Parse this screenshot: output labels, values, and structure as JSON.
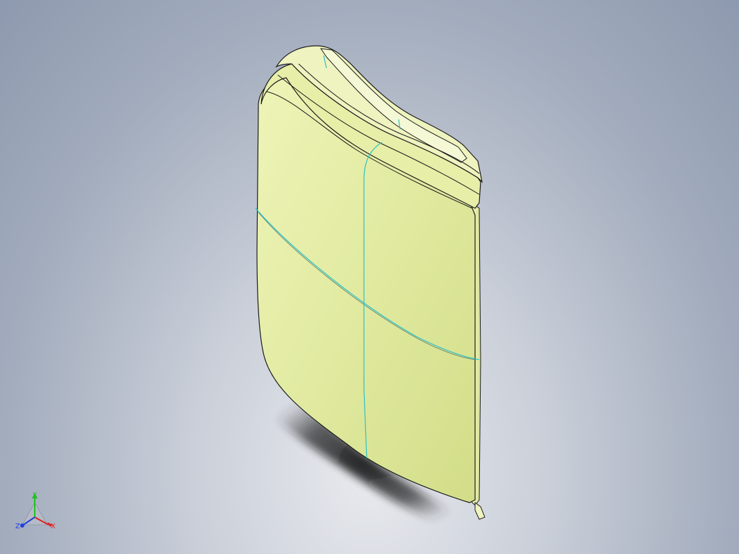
{
  "viewport": {
    "background_top": "#8d99ae",
    "background_bottom": "#eceef2",
    "part_color": "#dce696",
    "edge_color": "#1a1a1a",
    "curve_color": "#2ec8c8"
  },
  "triad": {
    "x_label": "X",
    "y_label": "Y",
    "z_label": "Z",
    "x_color": "#e02020",
    "y_color": "#20c020",
    "z_color": "#2040e0"
  }
}
